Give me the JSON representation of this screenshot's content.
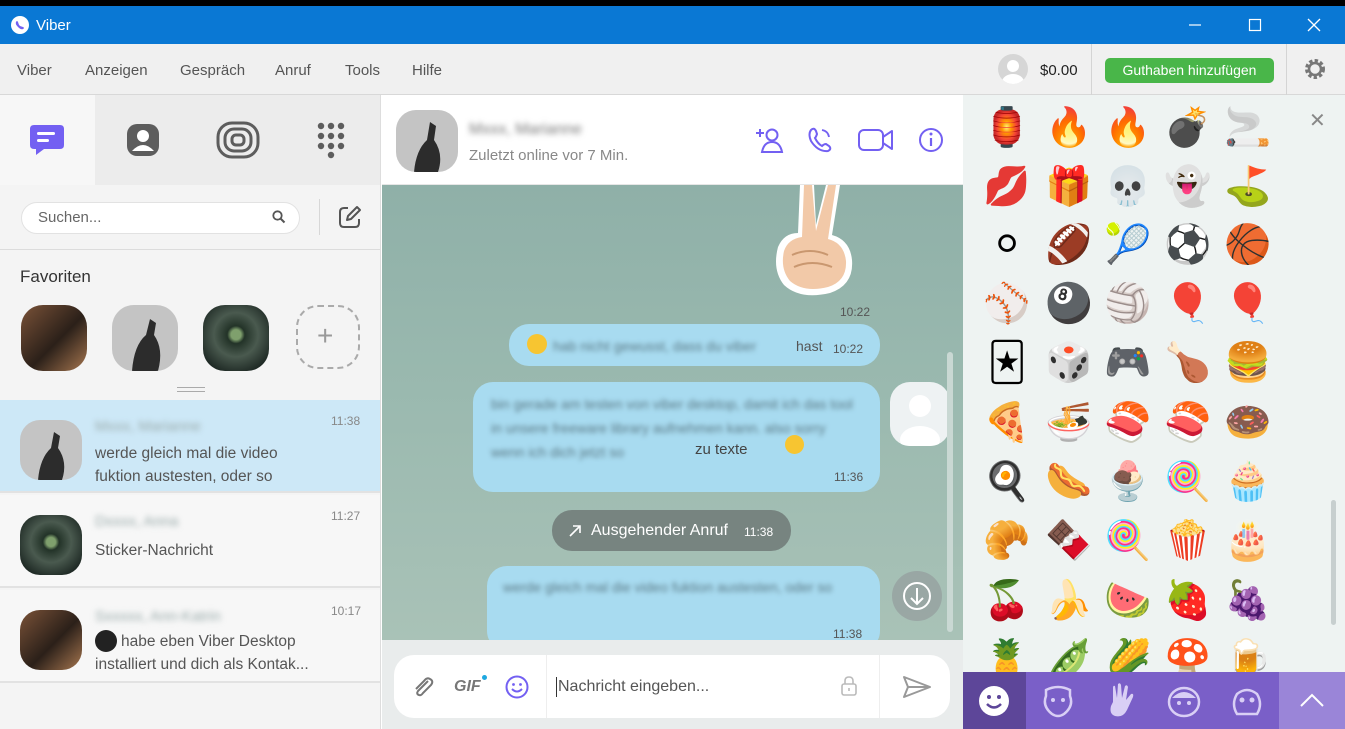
{
  "window": {
    "title": "Viber"
  },
  "menu": {
    "items": [
      "Viber",
      "Anzeigen",
      "Gespräch",
      "Anruf",
      "Tools",
      "Hilfe"
    ],
    "balance": "$0.00",
    "add_credit": "Guthaben hinzufügen"
  },
  "sidebar": {
    "search_placeholder": "Suchen...",
    "favorites_title": "Favoriten",
    "chats": [
      {
        "time": "11:38",
        "preview": "werde gleich mal die video fuktion austesten, oder so",
        "selected": true
      },
      {
        "time": "11:27",
        "preview": "Sticker-Nachricht"
      },
      {
        "time": "10:17",
        "preview": "habe eben Viber Desktop installiert und dich als Kontak..."
      }
    ]
  },
  "conversation": {
    "status": "Zuletzt online vor 7 Min.",
    "messages": [
      {
        "type": "sticker",
        "time": "10:22"
      },
      {
        "type": "text",
        "text": "hast",
        "time": "10:22"
      },
      {
        "type": "text",
        "text": "zu texte",
        "time": "11:36"
      },
      {
        "type": "call",
        "label": "Ausgehender Anruf",
        "time": "11:38"
      },
      {
        "type": "text",
        "time": "11:38"
      }
    ],
    "composer_placeholder": "Nachricht eingeben...",
    "gif_label": "GIF"
  },
  "colors": {
    "titlebar": "#0a78d4",
    "accent": "#7360f2",
    "credit_button": "#49b649",
    "bubble": "#a8dbf0",
    "sticker_tab_bar": "#7a5fc8"
  },
  "sticker_panel": {
    "emojis": [
      "🏮",
      "🔥",
      "🔥",
      "💣",
      "🚬",
      "💋",
      "🎁",
      "💀",
      "👻",
      "⛳",
      "⚪",
      "🏈",
      "🎾",
      "⚽",
      "🏀",
      "⚾",
      "🎱",
      "🏐",
      "🎈",
      "🎈",
      "🃏",
      "🎲",
      "🎮",
      "🍗",
      "🍔",
      "🍕",
      "🍜",
      "🍣",
      "🍣",
      "🍩",
      "🍳",
      "🌭",
      "🍨",
      "🍭",
      "🧁",
      "🥐",
      "🍫",
      "🍭",
      "🍿",
      "🎂",
      "🍒",
      "🍌",
      "🍉",
      "🍓",
      "🍇",
      "🍍",
      "🫛",
      "🌽",
      "🍄",
      "🍺"
    ],
    "tabs": [
      "smiley-icon",
      "bear-icon",
      "hand-icon",
      "face-icon",
      "creature-icon",
      "scroll-up-icon"
    ]
  }
}
